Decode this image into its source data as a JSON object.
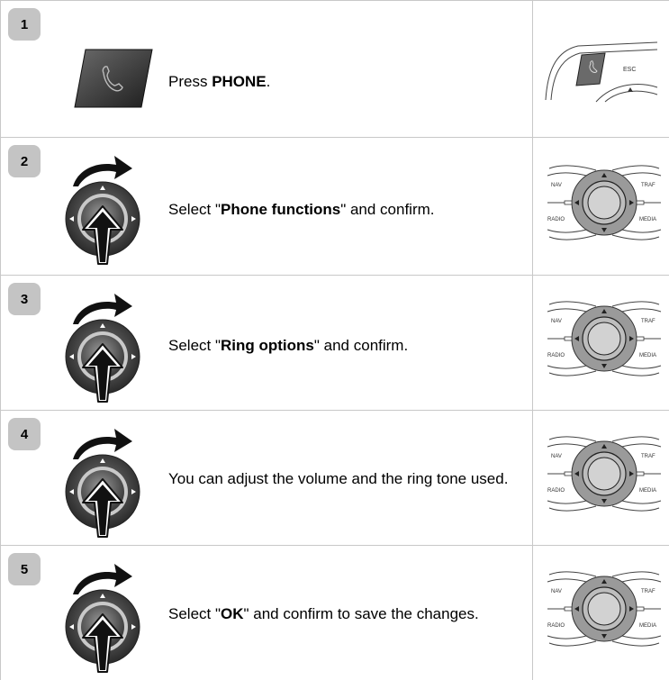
{
  "steps": [
    {
      "number": "1",
      "text_before": "Press ",
      "bold": "PHONE",
      "text_after": ".",
      "icon": "phone-key-icon"
    },
    {
      "number": "2",
      "text_before": "Select \"",
      "bold": "Phone functions",
      "text_after": "\" and confirm.",
      "icon": "rotary-controller-icon"
    },
    {
      "number": "3",
      "text_before": "Select \"",
      "bold": "Ring options",
      "text_after": "\" and confirm.",
      "icon": "rotary-controller-icon"
    },
    {
      "number": "4",
      "text_before": "You can adjust the volume and the ring tone used.",
      "bold": "",
      "text_after": "",
      "icon": "rotary-controller-icon"
    },
    {
      "number": "5",
      "text_before": "Select \"",
      "bold": "OK",
      "text_after": "\" and confirm to save the changes.",
      "icon": "rotary-controller-icon"
    }
  ],
  "panel_labels": {
    "esc": "ESC",
    "nav": "NAV",
    "traf": "TRAF",
    "radio": "RADIO",
    "media": "MEDIA"
  }
}
